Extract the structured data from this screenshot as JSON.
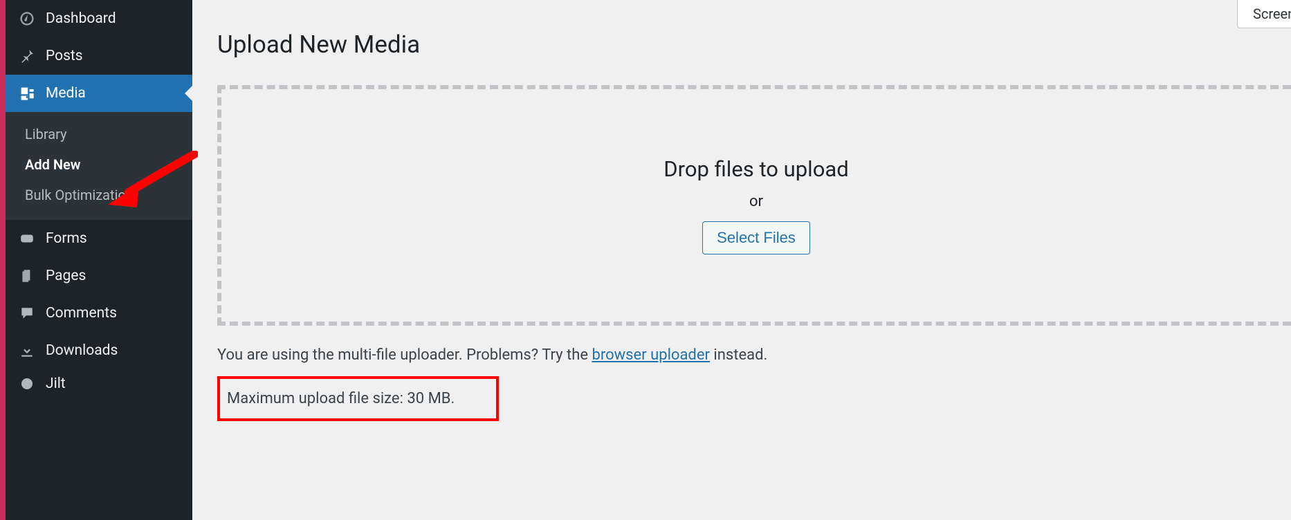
{
  "sidebar": {
    "items": [
      {
        "label": "Dashboard"
      },
      {
        "label": "Posts"
      },
      {
        "label": "Media"
      },
      {
        "label": "Forms"
      },
      {
        "label": "Pages"
      },
      {
        "label": "Comments"
      },
      {
        "label": "Downloads"
      },
      {
        "label": "Jilt"
      }
    ],
    "submenu": [
      {
        "label": "Library"
      },
      {
        "label": "Add New"
      },
      {
        "label": "Bulk Optimization"
      }
    ]
  },
  "screen_options_label": "Screen Options",
  "page_title": "Upload New Media",
  "dropzone": {
    "title": "Drop files to upload",
    "or": "or",
    "button": "Select Files"
  },
  "uploader_note": {
    "prefix": "You are using the multi-file uploader. Problems? Try the ",
    "link": "browser uploader",
    "suffix": " instead."
  },
  "max_size": "Maximum upload file size: 30 MB."
}
